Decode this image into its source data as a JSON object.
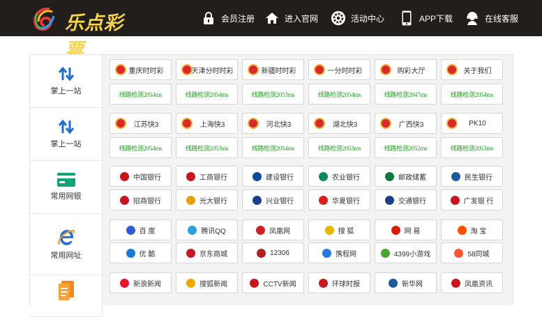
{
  "brand": {
    "name": "乐点彩票"
  },
  "nav": [
    {
      "label": "会员注册",
      "icon": "lock-icon"
    },
    {
      "label": "进入官网",
      "icon": "home-icon"
    },
    {
      "label": "活动中心",
      "icon": "gear-icon"
    },
    {
      "label": "APP下载",
      "icon": "phone-icon"
    },
    {
      "label": "在线客服",
      "icon": "support-icon"
    }
  ],
  "categories": [
    {
      "label": "掌上一站",
      "icon": "swap-arrows-icon"
    },
    {
      "label": "掌上一站",
      "icon": "swap-arrows-icon"
    },
    {
      "label": "常用网银",
      "icon": "bank-card-icon"
    },
    {
      "label": "常用网址",
      "icon": "ie-browser-icon"
    },
    {
      "label": "",
      "icon": "document-icon"
    }
  ],
  "lottery1": [
    {
      "label": "重庆时时彩",
      "speed": "线路检测2054ms"
    },
    {
      "label": "天津分时时彩",
      "speed": "线路检测2054ms"
    },
    {
      "label": "新疆时时彩",
      "speed": "线路检测2053ms"
    },
    {
      "label": "一分时时彩",
      "speed": "线路检测2054ms"
    },
    {
      "label": "购彩大厅",
      "speed": "线路检测2047ms"
    },
    {
      "label": "关于我们",
      "speed": "线路检测2054ms"
    }
  ],
  "lottery2": [
    {
      "label": "江苏快3",
      "speed": "线路检测2054ms"
    },
    {
      "label": "上海快3",
      "speed": "线路检测2053ms"
    },
    {
      "label": "河北快3",
      "speed": "线路检测2054ms"
    },
    {
      "label": "湖北快3",
      "speed": "线路检测2053ms"
    },
    {
      "label": "广西快3",
      "speed": "线路检测2052ms"
    },
    {
      "label": "PK10",
      "speed": "线路检测2053ms"
    }
  ],
  "banks": [
    {
      "label": "中国银行",
      "icon": "boc-icon",
      "color": "#c8161d"
    },
    {
      "label": "工商银行",
      "icon": "icbc-icon",
      "color": "#c8161d"
    },
    {
      "label": "建设银行",
      "icon": "ccb-icon",
      "color": "#0a4b9c"
    },
    {
      "label": "农业银行",
      "icon": "abc-icon",
      "color": "#0b8a5c"
    },
    {
      "label": "邮政储蓄",
      "icon": "psbc-icon",
      "color": "#0b7a3c"
    },
    {
      "label": "民生银行",
      "icon": "cmbc-icon",
      "color": "#1a5aa0"
    },
    {
      "label": "招商银行",
      "icon": "cmb-icon",
      "color": "#c8161d"
    },
    {
      "label": "光大银行",
      "icon": "ceb-icon",
      "color": "#e8a000"
    },
    {
      "label": "兴业银行",
      "icon": "cib-icon",
      "color": "#1a3f8c"
    },
    {
      "label": "华夏银行",
      "icon": "hxb-icon",
      "color": "#d4231c"
    },
    {
      "label": "交通银行",
      "icon": "bocom-icon",
      "color": "#1c3f8c"
    },
    {
      "label": "广发银 行",
      "icon": "cgb-icon",
      "color": "#c8161d"
    }
  ],
  "sites1": [
    {
      "label": "百 度",
      "icon": "baidu-paw-icon",
      "color": "#2f5bdb"
    },
    {
      "label": "腾讯QQ",
      "icon": "qq-icon",
      "color": "#2a9ee0"
    },
    {
      "label": "凤凰网",
      "icon": "ifeng-icon",
      "color": "#d02020"
    },
    {
      "label": "搜 狐",
      "icon": "sohu-icon",
      "color": "#e8b400"
    },
    {
      "label": "网 易",
      "icon": "netease-icon",
      "color": "#d81e06"
    },
    {
      "label": "淘 宝",
      "icon": "taobao-icon",
      "color": "#ff5000"
    },
    {
      "label": "优 酷",
      "icon": "youku-icon",
      "color": "#1a7ad8"
    },
    {
      "label": "京东商城",
      "icon": "jd-icon",
      "color": "#c81623"
    },
    {
      "label": "12306",
      "icon": "railway-icon",
      "color": "#b02020"
    },
    {
      "label": "携程网",
      "icon": "ctrip-icon",
      "color": "#2577e3"
    },
    {
      "label": "4399小游戏",
      "icon": "4399-icon",
      "color": "#4aa531"
    },
    {
      "label": "58同城",
      "icon": "58-icon",
      "color": "#ff552e"
    }
  ],
  "sites2": [
    {
      "label": "新浪新闻",
      "icon": "sina-icon",
      "color": "#e6162d"
    },
    {
      "label": "搜狐新闻",
      "icon": "sohu-news-icon",
      "color": "#f0a800"
    },
    {
      "label": "CCTV新闻",
      "icon": "cctv-icon",
      "color": "#c8161d"
    },
    {
      "label": "环球时报",
      "icon": "huanqiu-icon",
      "color": "#c8161d"
    },
    {
      "label": "新华网",
      "icon": "xinhua-icon",
      "color": "#1a5aa0"
    },
    {
      "label": "凤凰资讯",
      "icon": "ifeng-news-icon",
      "color": "#c8161d"
    }
  ]
}
